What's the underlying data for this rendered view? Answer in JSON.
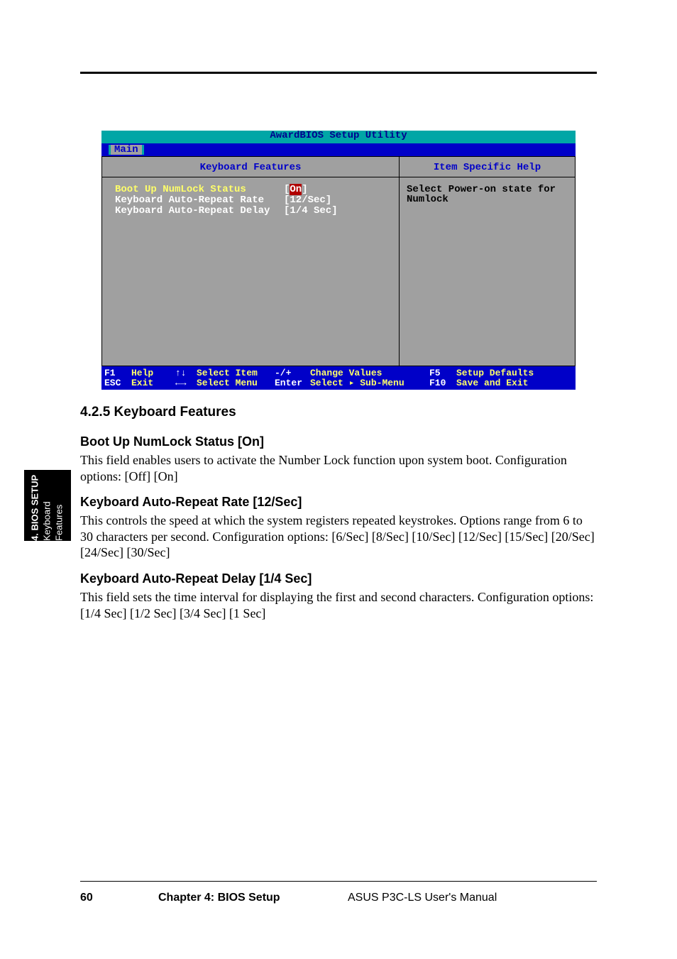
{
  "sidebar": {
    "line1": "4. BIOS SETUP",
    "line2": "Keyboard Features"
  },
  "bios": {
    "title": "AwardBIOS Setup Utility",
    "menu_tab": "Main",
    "left_heading": "Keyboard Features",
    "right_heading": "Item Specific Help",
    "rows": [
      {
        "label": "Boot Up NumLock Status",
        "value_pre": "[",
        "value_sel": "On",
        "value_post": "]",
        "selected": true
      },
      {
        "label": "Keyboard Auto-Repeat Rate",
        "value": "[12/Sec]"
      },
      {
        "label": "Keyboard Auto-Repeat Delay",
        "value": "[1/4 Sec]"
      }
    ],
    "help_text": "Select Power-on state for Numlock",
    "footer": {
      "r1": [
        "F1",
        "Help",
        "↑↓",
        "Select Item",
        "-/+",
        "Change Values",
        "F5",
        "Setup Defaults"
      ],
      "r2": [
        "ESC",
        "Exit",
        "←→",
        "Select Menu",
        "Enter",
        "Select ▸ Sub-Menu",
        "F10",
        "Save and Exit"
      ]
    }
  },
  "section": {
    "title": "4.2.5 Keyboard Features",
    "sub1": "Boot Up NumLock Status [On]",
    "para1": "This field enables users to activate the Number Lock function upon system boot. Configuration options: [Off] [On]",
    "sub2": "Keyboard Auto-Repeat Rate [12/Sec]",
    "para2": "This controls the speed at which the system registers repeated keystrokes. Options range from 6 to 30 characters per second. Configuration options: [6/Sec] [8/Sec] [10/Sec] [12/Sec] [15/Sec] [20/Sec] [24/Sec] [30/Sec]",
    "sub3": "Keyboard Auto-Repeat Delay [1/4 Sec]",
    "para3": "This field sets the time interval for displaying the first and second characters. Configuration options: [1/4 Sec] [1/2 Sec] [3/4 Sec] [1 Sec]"
  },
  "pageinfo": {
    "num": "60",
    "chapter": "Chapter 4: BIOS Setup",
    "title": "ASUS P3C-LS User's Manual"
  }
}
